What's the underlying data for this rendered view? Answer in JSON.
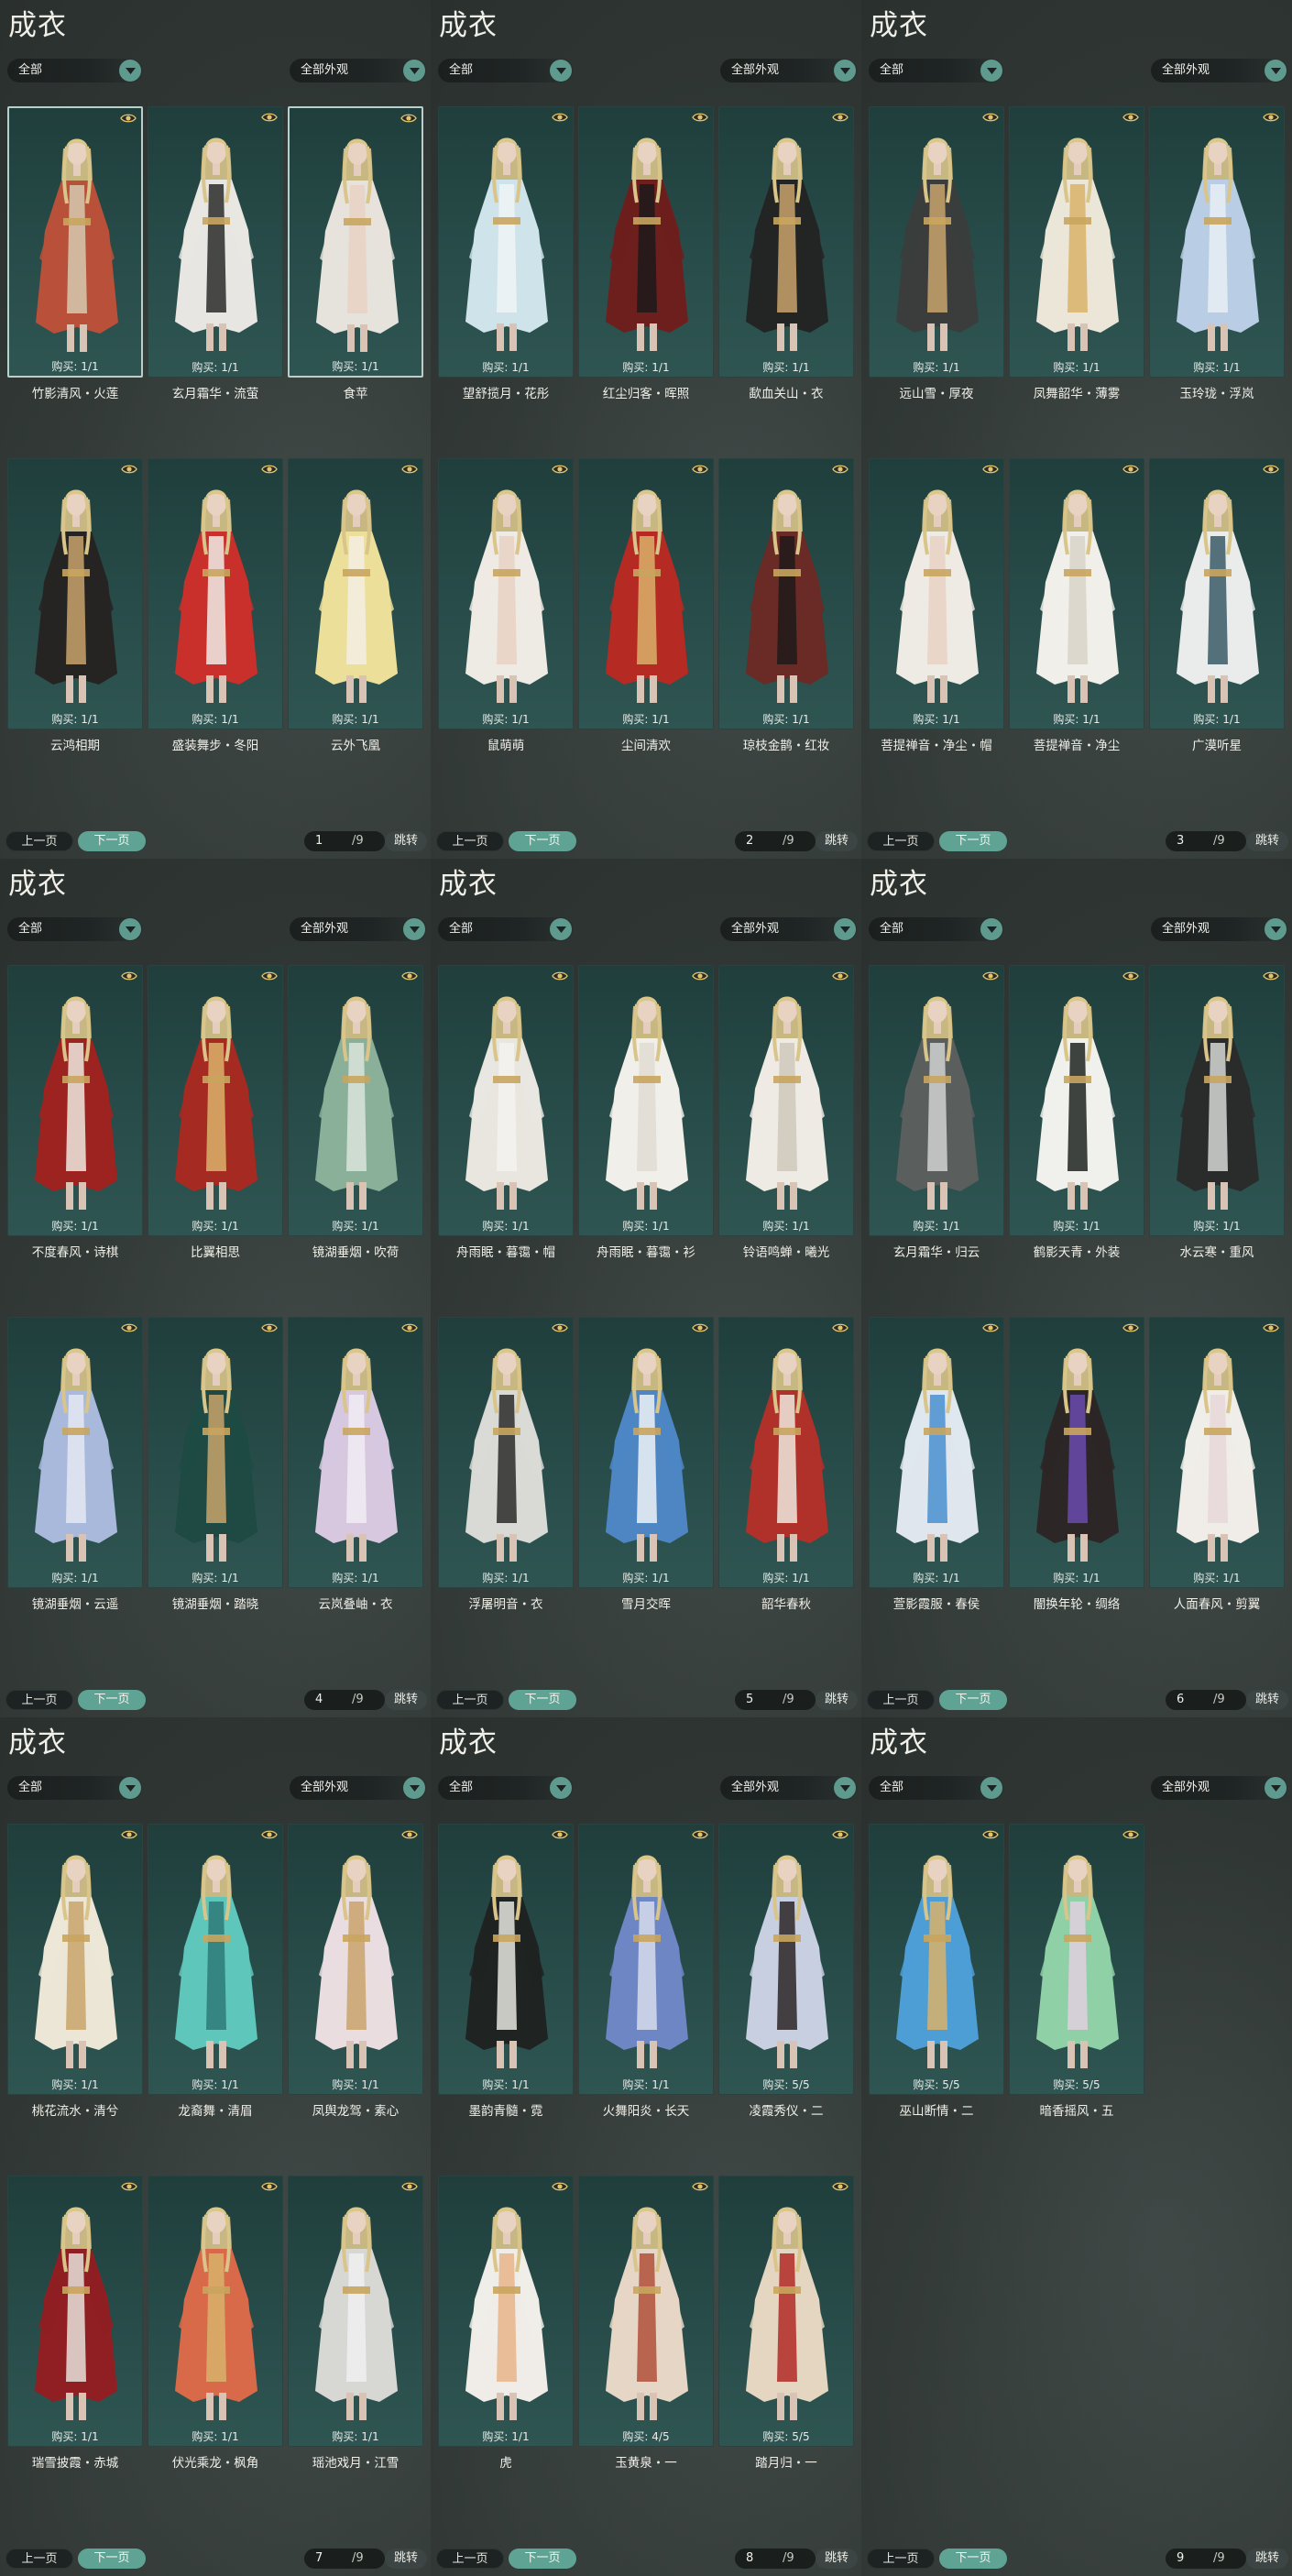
{
  "common": {
    "title": "成衣",
    "filter_left": "全部",
    "filter_right": "全部外观",
    "prev_label": "上一页",
    "next_label": "下一页",
    "jump_label": "跳转",
    "page_total": "/9",
    "icons": {
      "dropdown": "chevron-down-icon",
      "visibility": "eye-icon"
    },
    "colors": {
      "accent": "#5e9a8e",
      "card_bg": "#264a47",
      "panel_bg": "#2f3634"
    }
  },
  "panels": [
    {
      "page": "1",
      "items": [
        {
          "name": "竹影清风・火莲",
          "buy": "购买: 1/1",
          "selected": true,
          "color": "#b8503a",
          "accent": "#d5c9b0"
        },
        {
          "name": "玄月霜华・流萤",
          "buy": "购买: 1/1",
          "selected": false,
          "color": "#e8e6e2",
          "accent": "#2a2a2a"
        },
        {
          "name": "食苹",
          "buy": "购买: 1/1",
          "selected": true,
          "color": "#e6e2dc",
          "accent": "#e8d2c4"
        },
        {
          "name": "云鸿相期",
          "buy": "购买: 1/1",
          "selected": false,
          "color": "#262422",
          "accent": "#c9a36b"
        },
        {
          "name": "盛装舞步・冬阳",
          "buy": "购买: 1/1",
          "selected": false,
          "color": "#c9302c",
          "accent": "#f0ece6"
        },
        {
          "name": "云外飞凰",
          "buy": "购买: 1/1",
          "selected": false,
          "color": "#ecdf9a",
          "accent": "#f3efe4"
        }
      ]
    },
    {
      "page": "2",
      "items": [
        {
          "name": "望舒揽月・花彤",
          "buy": "购买: 1/1",
          "selected": false,
          "color": "#cfe3ea",
          "accent": "#eef4f6"
        },
        {
          "name": "红尘归客・晖照",
          "buy": "购买: 1/1",
          "selected": false,
          "color": "#6c1f1d",
          "accent": "#1c1a1a"
        },
        {
          "name": "歃血关山・衣",
          "buy": "购买: 1/1",
          "selected": false,
          "color": "#232524",
          "accent": "#c9a36b"
        },
        {
          "name": "鼠萌萌",
          "buy": "购买: 1/1",
          "selected": false,
          "color": "#eeeae4",
          "accent": "#e8d2c4"
        },
        {
          "name": "尘间清欢",
          "buy": "购买: 1/1",
          "selected": false,
          "color": "#b52a22",
          "accent": "#d9b26a"
        },
        {
          "name": "琼枝金鹊・红妆",
          "buy": "购买: 1/1",
          "selected": false,
          "color": "#6a2a26",
          "accent": "#1d1a1a"
        }
      ]
    },
    {
      "page": "3",
      "items": [
        {
          "name": "远山雪・厚夜",
          "buy": "购买: 1/1",
          "selected": false,
          "color": "#3a3d3c",
          "accent": "#c9a36b"
        },
        {
          "name": "凤舞韶华・薄雾",
          "buy": "购买: 1/1",
          "selected": false,
          "color": "#ebe6d8",
          "accent": "#d9b26a"
        },
        {
          "name": "玉玲珑・浮岚",
          "buy": "购买: 1/1",
          "selected": false,
          "color": "#b9cde4",
          "accent": "#e8eef4"
        },
        {
          "name": "菩提禅音・净尘・帽",
          "buy": "购买: 1/1",
          "selected": false,
          "color": "#eeeae4",
          "accent": "#e8d2c4"
        },
        {
          "name": "菩提禅音・净尘",
          "buy": "购买: 1/1",
          "selected": false,
          "color": "#f0efe9",
          "accent": "#d9d4c8"
        },
        {
          "name": "广漠听星",
          "buy": "购买: 1/1",
          "selected": false,
          "color": "#e9ecea",
          "accent": "#3a5a66"
        }
      ]
    },
    {
      "page": "4",
      "items": [
        {
          "name": "不度春风・诗棋",
          "buy": "购买: 1/1",
          "selected": false,
          "color": "#9c2320",
          "accent": "#efe9df"
        },
        {
          "name": "比翼相思",
          "buy": "购买: 1/1",
          "selected": false,
          "color": "#a52a22",
          "accent": "#d9b26a"
        },
        {
          "name": "镜湖垂烟・吹荷",
          "buy": "购买: 1/1",
          "selected": false,
          "color": "#8ab09a",
          "accent": "#d9e4dc"
        },
        {
          "name": "镜湖垂烟・云遥",
          "buy": "购买: 1/1",
          "selected": false,
          "color": "#a9b9dc",
          "accent": "#e4e8f2"
        },
        {
          "name": "镜湖垂烟・踏晓",
          "buy": "购买: 1/1",
          "selected": false,
          "color": "#1f4a44",
          "accent": "#c9a36b"
        },
        {
          "name": "云岚叠岫・衣",
          "buy": "购买: 1/1",
          "selected": false,
          "color": "#d7c8e0",
          "accent": "#f1ecf3"
        }
      ]
    },
    {
      "page": "5",
      "items": [
        {
          "name": "舟雨眠・暮霭・帽",
          "buy": "购买: 1/1",
          "selected": false,
          "color": "#e9e6e0",
          "accent": "#f4f2ee"
        },
        {
          "name": "舟雨眠・暮霭・衫",
          "buy": "购买: 1/1",
          "selected": false,
          "color": "#f1efea",
          "accent": "#e0dcd4"
        },
        {
          "name": "铃语鸣蝉・曦光",
          "buy": "购买: 1/1",
          "selected": false,
          "color": "#eeebe4",
          "accent": "#cfc9bc"
        },
        {
          "name": "浮屠明音・衣",
          "buy": "购买: 1/1",
          "selected": false,
          "color": "#d9d9d6",
          "accent": "#2a2a2a"
        },
        {
          "name": "雪月交晖",
          "buy": "购买: 1/1",
          "selected": false,
          "color": "#4e86c4",
          "accent": "#eef2f6"
        },
        {
          "name": "韶华春秋",
          "buy": "购买: 1/1",
          "selected": false,
          "color": "#b0302a",
          "accent": "#efe9df"
        }
      ]
    },
    {
      "page": "6",
      "items": [
        {
          "name": "玄月霜华・归云",
          "buy": "购买: 1/1",
          "selected": false,
          "color": "#5a5e5d",
          "accent": "#d0d2d0"
        },
        {
          "name": "鹤影天青・外装",
          "buy": "购买: 1/1",
          "selected": false,
          "color": "#f0f0ec",
          "accent": "#1f2422"
        },
        {
          "name": "水云寒・重风",
          "buy": "购买: 1/1",
          "selected": false,
          "color": "#2a2c2c",
          "accent": "#d6d8d6"
        },
        {
          "name": "萱影霞服・春侯",
          "buy": "购买: 1/1",
          "selected": false,
          "color": "#dfe6ee",
          "accent": "#4a8fcf"
        },
        {
          "name": "闇换年轮・绸络",
          "buy": "购买: 1/1",
          "selected": false,
          "color": "#2c2626",
          "accent": "#6a4bb0"
        },
        {
          "name": "人面春风・剪翼",
          "buy": "购买: 1/1",
          "selected": false,
          "color": "#f0ede8",
          "accent": "#e8d6d8"
        }
      ]
    },
    {
      "page": "7",
      "items": [
        {
          "name": "桃花流水・清兮",
          "buy": "购买: 1/1",
          "selected": false,
          "color": "#ece6d6",
          "accent": "#c9a36b"
        },
        {
          "name": "龙裔舞・清眉",
          "buy": "购买: 1/1",
          "selected": false,
          "color": "#5fc6bc",
          "accent": "#2e7a78"
        },
        {
          "name": "凤舆龙驾・素心",
          "buy": "购买: 1/1",
          "selected": false,
          "color": "#e9dde0",
          "accent": "#c9a36b"
        },
        {
          "name": "瑞雪披霞・赤城",
          "buy": "购买: 1/1",
          "selected": false,
          "color": "#8f1f22",
          "accent": "#e8e2da"
        },
        {
          "name": "伏光乘龙・枫角",
          "buy": "购买: 1/1",
          "selected": false,
          "color": "#d86a4a",
          "accent": "#d9b26a"
        },
        {
          "name": "瑶池戏月・江雪",
          "buy": "购买: 1/1",
          "selected": false,
          "color": "#d7d7d4",
          "accent": "#eef0ee"
        }
      ]
    },
    {
      "page": "8",
      "items": [
        {
          "name": "墨韵青髓・霓",
          "buy": "购买: 1/1",
          "selected": false,
          "color": "#1f2322",
          "accent": "#e8e6e0"
        },
        {
          "name": "火舞阳炎・长天",
          "buy": "购买: 1/1",
          "selected": false,
          "color": "#6f86c4",
          "accent": "#d6dcec"
        },
        {
          "name": "凌霞秀仪・二",
          "buy": "购买: 5/5",
          "selected": false,
          "color": "#c8cfe0",
          "accent": "#2a2426"
        },
        {
          "name": "虎",
          "buy": "购买: 1/1",
          "selected": false,
          "color": "#f0ede8",
          "accent": "#e6b48a"
        },
        {
          "name": "玉黄泉・一",
          "buy": "购买: 4/5",
          "selected": false,
          "color": "#e6d6c6",
          "accent": "#b0503a"
        },
        {
          "name": "踏月归・一",
          "buy": "购买: 5/5",
          "selected": false,
          "color": "#e4d6c0",
          "accent": "#b02a26"
        }
      ]
    },
    {
      "page": "9",
      "items": [
        {
          "name": "巫山断情・二",
          "buy": "购买: 5/5",
          "selected": false,
          "color": "#4e9ed6",
          "accent": "#d9b26a"
        },
        {
          "name": "暗香摇风・五",
          "buy": "购买: 5/5",
          "selected": false,
          "color": "#8fd0a6",
          "accent": "#e2cfe0"
        }
      ]
    }
  ]
}
